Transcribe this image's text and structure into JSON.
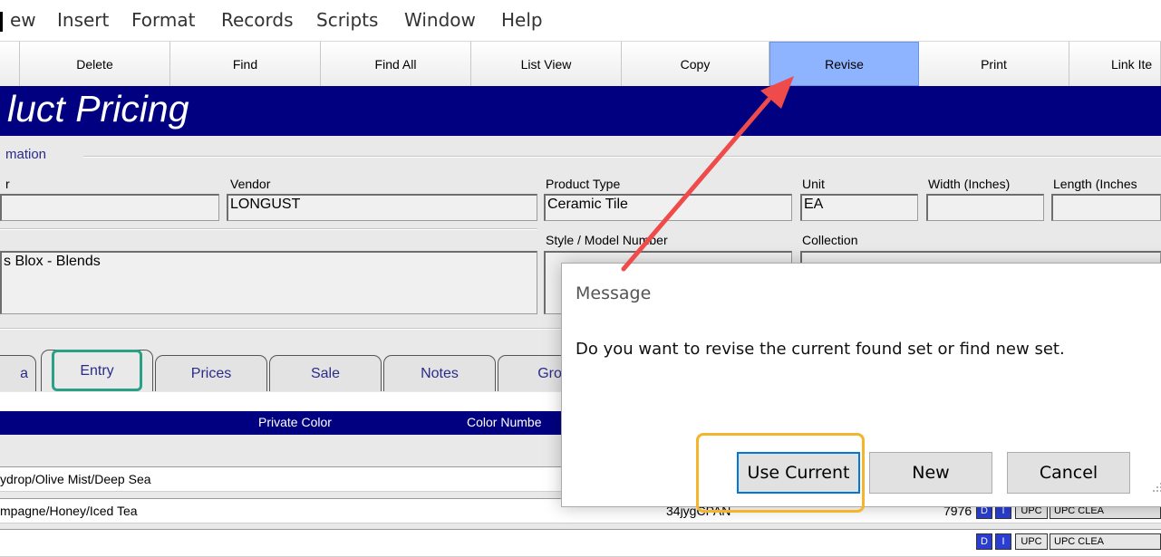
{
  "menu": {
    "items": [
      "ew",
      "Insert",
      "Format",
      "Records",
      "Scripts",
      "Window",
      "Help"
    ]
  },
  "toolbar": {
    "buttons": [
      "Delete",
      "Find",
      "Find All",
      "List View",
      "Copy",
      "Revise",
      "Print",
      "Link Ite"
    ],
    "active": "Revise"
  },
  "page": {
    "title": "luct Pricing"
  },
  "form": {
    "section": "mation",
    "labels": {
      "left": "r",
      "vendor": "Vendor",
      "product_type": "Product Type",
      "unit": "Unit",
      "width": "Width (Inches)",
      "length": "Length (Inches",
      "style": "Style / Model Number",
      "collection": "Collection"
    },
    "values": {
      "left": "",
      "vendor": "LONGUST",
      "product_type": "Ceramic Tile",
      "unit": "EA",
      "width": "",
      "length": "",
      "description": "s Blox - Blends"
    }
  },
  "tabs": {
    "items": [
      "a",
      "Entry",
      "Prices",
      "Sale",
      "Notes",
      "Grou"
    ],
    "selected": "Entry"
  },
  "list": {
    "columns": [
      "Private Color",
      "Color Numbe"
    ],
    "rows": [
      {
        "text": "ydrop/Olive Mist/Deep Sea",
        "code": "",
        "num": ""
      },
      {
        "text": "mpagne/Honey/Iced Tea",
        "code": "34jygCPAN",
        "num": "7976"
      },
      {
        "text": "",
        "code": "",
        "num": ""
      }
    ],
    "row_buttons": {
      "d": "D",
      "i": "I",
      "upc": "UPC",
      "upc_clear": "UPC CLEA"
    }
  },
  "dialog": {
    "title": "Message",
    "message": "Do you want to revise the current found set or find new set.",
    "buttons": [
      "Use Current",
      "New",
      "Cancel"
    ]
  },
  "colors": {
    "title_band": "#000080",
    "active_toolbar": "#8fb4ff",
    "arrow": "#f04b4b",
    "tab_highlight": "#2aa187",
    "button_highlight": "#f3b52c"
  }
}
